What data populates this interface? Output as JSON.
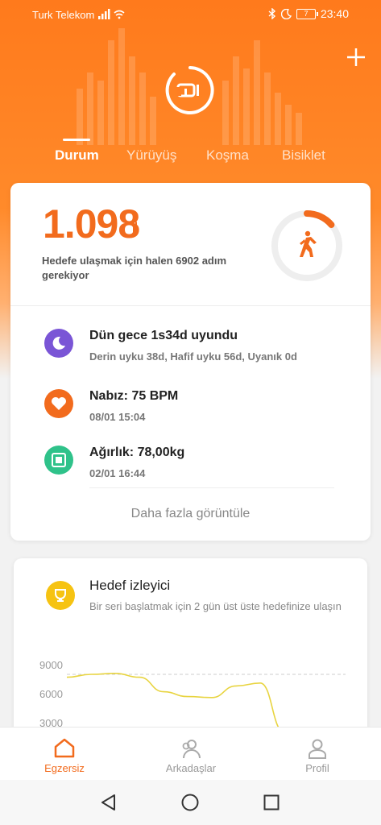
{
  "status_bar": {
    "carrier": "Turk Telekom",
    "battery": "7",
    "time": "23:40"
  },
  "tabs": [
    "Durum",
    "Yürüyüş",
    "Koşma",
    "Bisiklet"
  ],
  "steps": {
    "value": "1.098",
    "subtitle": "Hedefe ulaşmak için halen 6902 adım gerekiyor",
    "progress_fraction": 0.137
  },
  "metrics": [
    {
      "title": "Dün gece 1s34d uyundu",
      "sub": "Derin uyku 38d, Hafif uyku 56d, Uyanık 0d",
      "icon": "moon-icon",
      "color": "#7a55d6"
    },
    {
      "title": "Nabız: 75 BPM",
      "sub": "08/01 15:04",
      "icon": "heart-icon",
      "color": "#f26b1d"
    },
    {
      "title": "Ağırlık: 78,00kg",
      "sub": "02/01 16:44",
      "icon": "scale-icon",
      "color": "#2fc28a"
    }
  ],
  "more_label": "Daha fazla görüntüle",
  "goal_tracker": {
    "title": "Hedef izleyici",
    "subtitle": "Bir seri başlatmak için 2 gün üst üste hedefinize ulaşın"
  },
  "chart_data": {
    "type": "line",
    "y_ticks": [
      "9000",
      "6000",
      "3000"
    ],
    "goal_line": 8000,
    "values": [
      7700,
      8000,
      8100,
      7700,
      6200,
      5700,
      5600,
      6800,
      7100,
      2000
    ],
    "ylim": [
      3000,
      9000
    ],
    "colors": {
      "line": "#e8d440",
      "goal": "#cccccc"
    }
  },
  "bottom_nav": [
    {
      "label": "Egzersiz",
      "icon": "home-icon",
      "active": true
    },
    {
      "label": "Arkadaşlar",
      "icon": "friends-icon",
      "active": false
    },
    {
      "label": "Profil",
      "icon": "profile-icon",
      "active": false
    }
  ],
  "colors": {
    "accent": "#f26b1d",
    "header_top": "#ff7a1c"
  }
}
